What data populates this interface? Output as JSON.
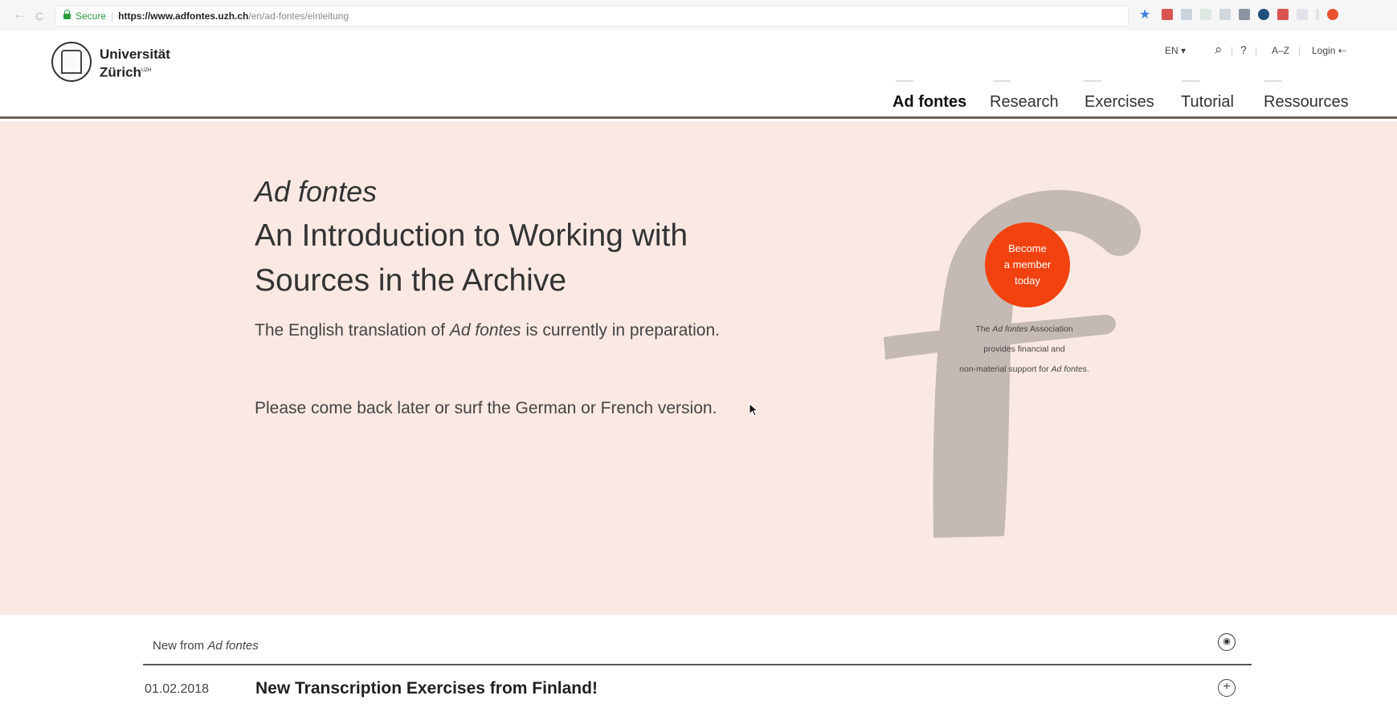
{
  "browser": {
    "back": "←",
    "reload": "C",
    "secure_label": "Secure",
    "url_host": "https://www.adfontes.uzh.ch",
    "url_path": "/en/ad-fontes/einleitung",
    "bookmark_icon": "★"
  },
  "header": {
    "logo_line1": "Universität",
    "logo_line2": "Zürich",
    "logo_sup": "UZH",
    "lang": "EN ▾",
    "search_icon": "⌕",
    "help": "?",
    "az": "A–Z",
    "login": "Login ⇠",
    "nav": [
      "Ad fontes",
      "Research",
      "Exercises",
      "Tutorial",
      "Ressources"
    ]
  },
  "hero": {
    "title_italic": "Ad fontes",
    "title_line1": "An Introduction to Working with",
    "title_line2": "Sources in the Archive",
    "intro_pre": "The English translation of ",
    "intro_em": "Ad fontes",
    "intro_post": " is currently in preparation.",
    "intro2": "Please come back later or surf the German or French version."
  },
  "promo": {
    "circle_line1": "Become",
    "circle_line2": "a member",
    "circle_line3": "today",
    "assoc_pre": "The ",
    "assoc_em": "Ad fontes",
    "assoc_mid": " Association",
    "assoc_line2": "provides financial and",
    "assoc_line3_pre": "non-material support for ",
    "assoc_line3_em": "Ad fontes",
    "assoc_line3_post": "."
  },
  "news": {
    "label_pre": "New from ",
    "label_em": "Ad fontes",
    "items": [
      {
        "date": "01.02.2018",
        "title": "New Transcription Exercises from Finland!"
      }
    ]
  },
  "colors": {
    "hero_bg": "#fae9e3",
    "accent": "#f2420f",
    "nav_rule": "#6b6058"
  }
}
